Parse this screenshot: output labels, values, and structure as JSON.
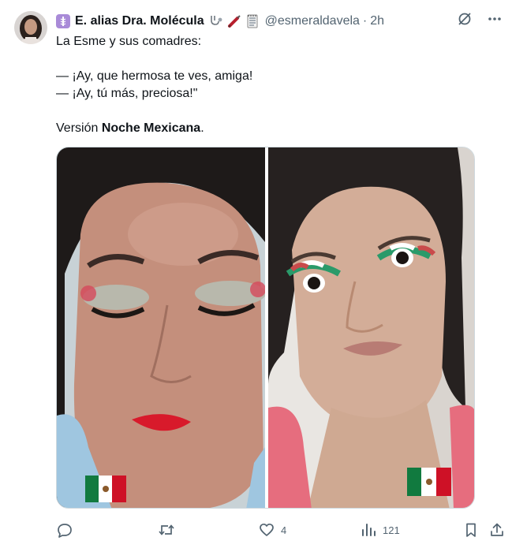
{
  "author": {
    "name": "E. alias Dra. Molécula",
    "prefix_emoji": "medical-symbol-icon",
    "suffix_emojis": [
      "stethoscope-icon",
      "syringe-icon",
      "notepad-icon"
    ],
    "handle": "@esmeraldavela",
    "separator": "·",
    "time": "2h"
  },
  "tweet": {
    "line1": "La Esme y sus comadres:",
    "line2": "— ¡Ay, que hermosa te ves, amiga!",
    "line3": "— ¡Ay, tú más, preciosa!\"",
    "line4_prefix": "Versión ",
    "line4_bold": "Noche Mexicana",
    "line4_suffix": "."
  },
  "media": {
    "left_flag": "mexico-flag-icon",
    "right_flag": "mexico-flag-icon"
  },
  "actions": {
    "reply_count": "",
    "retweet_count": "",
    "like_count": "4",
    "views_count": "121"
  },
  "colors": {
    "text": "#0f1419",
    "secondary": "#536471",
    "border": "#cfd9de"
  }
}
